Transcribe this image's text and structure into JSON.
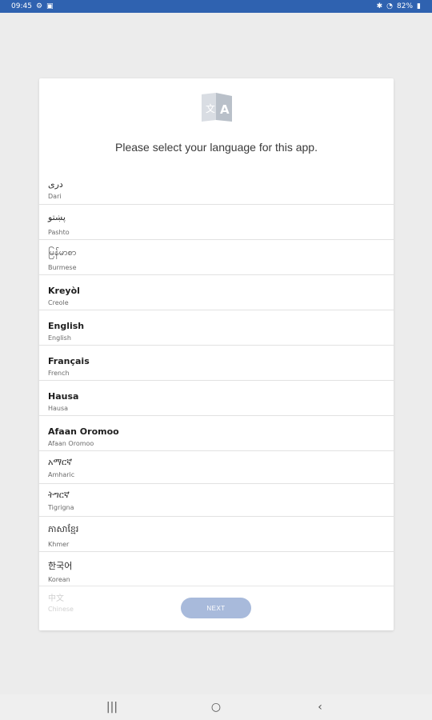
{
  "status_bar": {
    "time": "09:45",
    "battery": "82%"
  },
  "prompt": "Please select your language for this app.",
  "languages": [
    {
      "native": "دری",
      "english": "Dari"
    },
    {
      "native": "پښتو",
      "english": "Pashto"
    },
    {
      "native": "မြန်မာစာ",
      "english": "Burmese"
    },
    {
      "native": "Kreyòl",
      "english": "Creole"
    },
    {
      "native": "English",
      "english": "English"
    },
    {
      "native": "Français",
      "english": "French"
    },
    {
      "native": "Hausa",
      "english": "Hausa"
    },
    {
      "native": "Afaan Oromoo",
      "english": "Afaan Oromoo"
    },
    {
      "native": "አማርኛ",
      "english": "Amharic"
    },
    {
      "native": "ትግርኛ",
      "english": "Tigrigna"
    },
    {
      "native": "ភាសាខ្មែរ",
      "english": "Khmer"
    },
    {
      "native": "한국어",
      "english": "Korean"
    }
  ],
  "footer": {
    "next_label": "NEXT",
    "partial_native": "中文",
    "partial_english": "Chinese"
  },
  "colors": {
    "status_bar": "#2f62b0",
    "next_button": "#a8badb"
  }
}
